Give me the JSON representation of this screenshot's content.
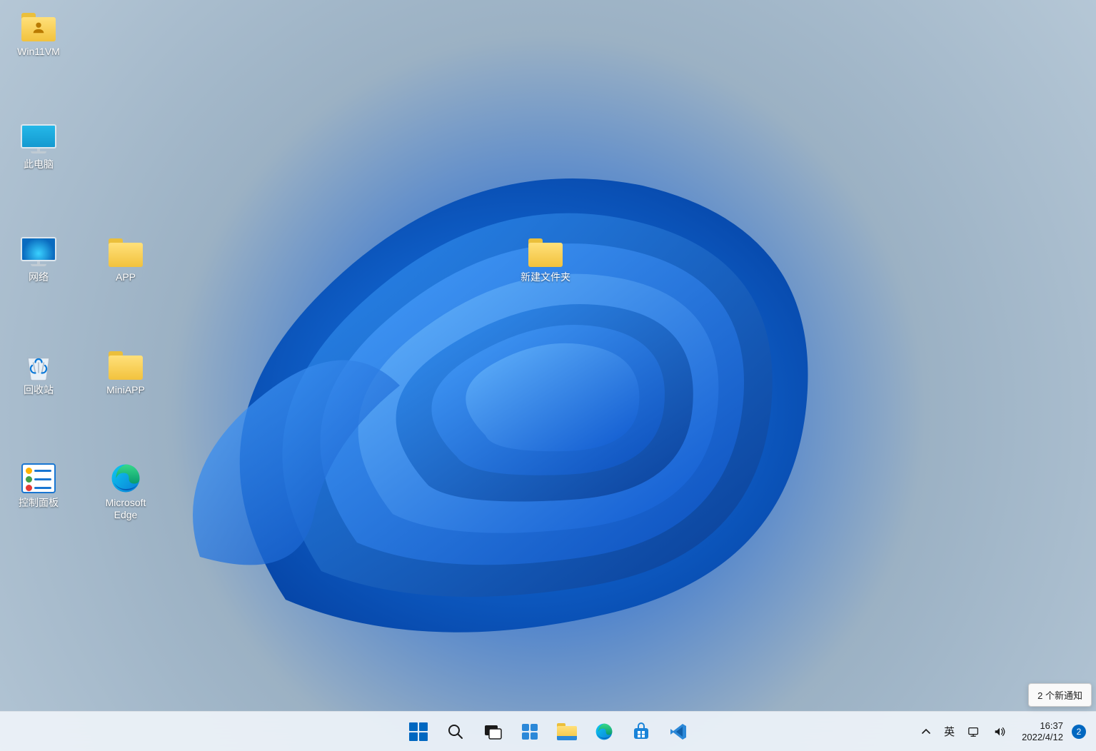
{
  "desktop_icons": {
    "user_folder": "Win11VM",
    "this_pc": "此电脑",
    "network": "网络",
    "app_folder": "APP",
    "recycle_bin": "回收站",
    "miniapp_folder": "MiniAPP",
    "control_panel": "控制面板",
    "edge_line1": "Microsoft",
    "edge_line2": "Edge",
    "new_folder": "新建文件夹"
  },
  "taskbar": {
    "pinned": {
      "start": "start",
      "search": "search",
      "task_view": "task-view",
      "widgets": "widgets",
      "explorer": "file-explorer",
      "edge": "edge",
      "store": "store",
      "vscode": "vscode"
    }
  },
  "tray": {
    "chevron": "▴",
    "ime_lang": "英",
    "time": "16:37",
    "date": "2022/4/12",
    "notif_count": "2",
    "notif_tooltip": "2 个新通知"
  }
}
